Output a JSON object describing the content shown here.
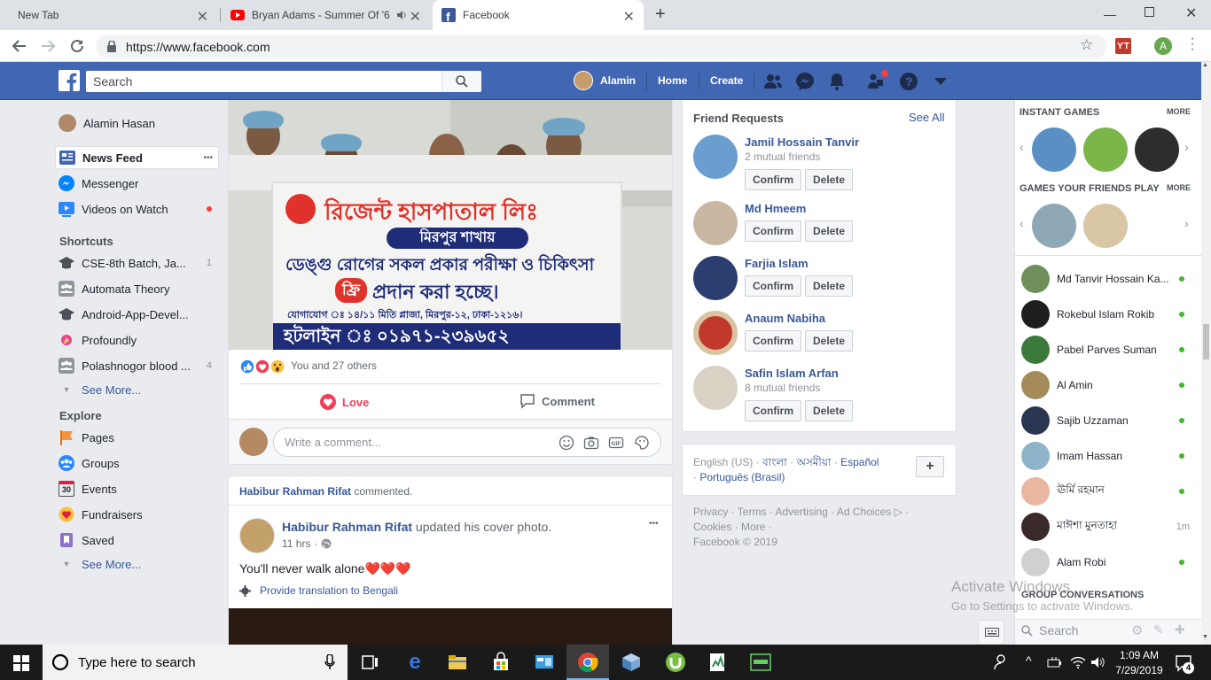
{
  "browser": {
    "tabs": [
      {
        "label": "New Tab"
      },
      {
        "label": "Bryan Adams - Summer Of '6"
      },
      {
        "label": "Facebook"
      }
    ],
    "url": "https://www.facebook.com",
    "profile_initial": "A",
    "extension_label": "ƳT"
  },
  "header": {
    "search_placeholder": "Search",
    "user_name": "Alamin",
    "home_label": "Home",
    "create_label": "Create"
  },
  "left_nav": {
    "profile_name": "Alamin Hasan",
    "main": [
      {
        "label": "News Feed"
      },
      {
        "label": "Messenger"
      },
      {
        "label": "Videos on Watch"
      }
    ],
    "more_dots": "•••",
    "shortcuts_title": "Shortcuts",
    "shortcuts": [
      {
        "label": "CSE-8th Batch, Ja...",
        "count": "1"
      },
      {
        "label": "Automata Theory",
        "count": ""
      },
      {
        "label": "Android-App-Devel...",
        "count": ""
      },
      {
        "label": "Profoundly",
        "count": ""
      },
      {
        "label": "Polashnogor blood ...",
        "count": "4"
      }
    ],
    "see_more": "See More...",
    "explore_title": "Explore",
    "explore": [
      {
        "label": "Pages"
      },
      {
        "label": "Groups"
      },
      {
        "label": "Events"
      },
      {
        "label": "Fundraisers"
      },
      {
        "label": "Saved"
      }
    ],
    "events_day": "30"
  },
  "post1": {
    "banner_line1": "রিজেন্ট হাসপাতাল লিঃ",
    "banner_line2": "মিরপুর শাখায়",
    "banner_line3": "ডেঙ্গু রোগের সকল প্রকার পরীক্ষা ও চিকিৎসা",
    "banner_free": "ফ্রি",
    "banner_line4": "প্রদান করা হচ্ছে।",
    "banner_line5": "যোগাযোগ ঃ ১৪/১১ মিতি প্লাজা, মিরপুর-১২, ঢাকা-১২১৬।",
    "banner_line6": "হটলাইন ঃ ০১৯৭১-২৩৯৬৫২",
    "reactions_text": "You and 27 others",
    "love_label": "Love",
    "comment_label": "Comment",
    "comment_placeholder": "Write a comment..."
  },
  "post2": {
    "context_name": "Habibur Rahman Rifat",
    "context_action": "commented.",
    "author": "Habibur Rahman Rifat",
    "action": "updated his cover photo.",
    "time": "11 hrs",
    "more_dots": "•••",
    "text": "You'll never walk alone❤️❤️❤️",
    "translate": "Provide translation to Bengali"
  },
  "friend_requests": {
    "title": "Friend Requests",
    "see_all": "See All",
    "confirm_label": "Confirm",
    "delete_label": "Delete",
    "items": [
      {
        "name": "Jamil Hossain Tanvir",
        "mutual": "2 mutual friends"
      },
      {
        "name": "Md Hmeem",
        "mutual": ""
      },
      {
        "name": "Farjia Islam",
        "mutual": ""
      },
      {
        "name": "Anaum Nabiha",
        "mutual": ""
      },
      {
        "name": "Safin Islam Arfan",
        "mutual": "8 mutual friends"
      }
    ]
  },
  "languages": {
    "current": "English (US)",
    "options": [
      "বাংলা",
      "অসমীয়া",
      "Español",
      "Português (Brasil)"
    ],
    "add_label": "+"
  },
  "footer": {
    "links": [
      "Privacy",
      "Terms",
      "Advertising",
      "Ad Choices",
      "Cookies",
      "More"
    ],
    "copyright": "Facebook © 2019"
  },
  "chat": {
    "instant_games_title": "INSTANT GAMES",
    "friends_play_title": "GAMES YOUR FRIENDS PLAY",
    "more_label": "MORE",
    "contacts": [
      {
        "name": "Md Tanvir Hossain Ka...",
        "status": "online"
      },
      {
        "name": "Rokebul Islam Rokib",
        "status": "online"
      },
      {
        "name": "Pabel Parves Suman",
        "status": "online"
      },
      {
        "name": "Al Amin",
        "status": "online"
      },
      {
        "name": "Sajib Uzzaman",
        "status": "online"
      },
      {
        "name": "Imam Hassan",
        "status": "online"
      },
      {
        "name": "ঊর্মি রহমান",
        "status": "online"
      },
      {
        "name": "মাঈশা মুনতাহা",
        "status": "1m"
      },
      {
        "name": "Alam Robi",
        "status": "online"
      }
    ],
    "group_conversations_title": "GROUP CONVERSATIONS",
    "search_placeholder": "Search"
  },
  "watermark": {
    "line1": "Activate Windows",
    "line2": "Go to Settings to activate Windows."
  },
  "taskbar": {
    "search_placeholder": "Type here to search",
    "time": "1:09 AM",
    "date": "7/29/2019",
    "notification_count": "4"
  },
  "colors": {
    "fb_blue": "#4267b2",
    "link_blue": "#385898",
    "love_red": "#f33e58",
    "online_green": "#42b72a",
    "banner_red": "#e0322b",
    "banner_navy": "#1f2d79"
  }
}
